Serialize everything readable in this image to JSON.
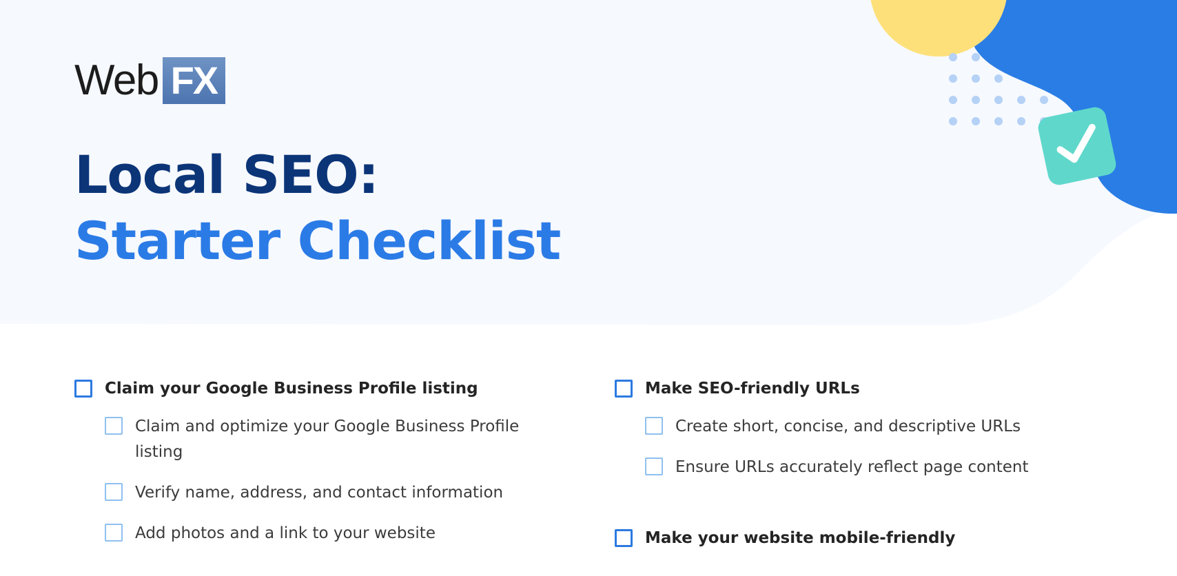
{
  "logo": {
    "word": "Web",
    "box": "FX"
  },
  "title": {
    "line1": "Local SEO:",
    "line2": "Starter Checklist"
  },
  "colors": {
    "navy": "#0c3578",
    "accent_blue": "#2b7be6",
    "hero_bg": "#f6f9fe",
    "yellow": "#fde07a",
    "teal": "#5fd8cb",
    "blob_blue": "#2a7de4"
  },
  "checklist": {
    "left": {
      "label": "Claim your Google Business Profile listing",
      "items": [
        {
          "label": "Claim and optimize your Google Business Profile listing"
        },
        {
          "label": "Verify name, address, and contact information"
        },
        {
          "label": "Add photos and a link to your website"
        }
      ]
    },
    "right": [
      {
        "label": "Make SEO-friendly URLs",
        "items": [
          {
            "label": "Create short, concise, and descriptive URLs"
          },
          {
            "label": "Ensure URLs accurately reflect page content"
          }
        ]
      },
      {
        "label": "Make your website mobile-friendly",
        "items": []
      }
    ]
  },
  "decorations": {
    "check_icon": "check-icon"
  }
}
